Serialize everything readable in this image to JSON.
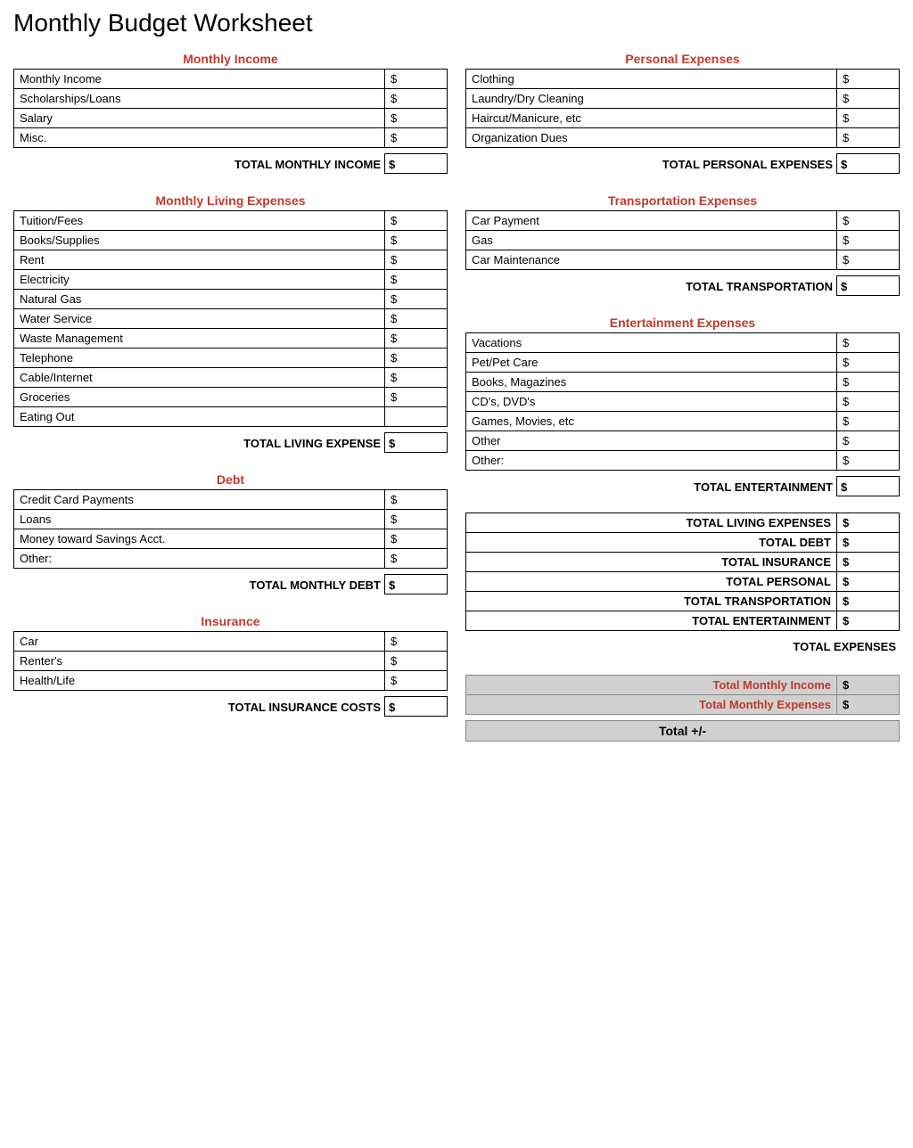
{
  "title": "Monthly Budget Worksheet",
  "left": {
    "monthly_income": {
      "heading": "Monthly Income",
      "rows": [
        {
          "label": "Monthly Income",
          "value": "$"
        },
        {
          "label": "Scholarships/Loans",
          "value": "$"
        },
        {
          "label": "Salary",
          "value": "$"
        },
        {
          "label": "Misc.",
          "value": "$"
        }
      ],
      "total_label": "TOTAL MONTHLY INCOME",
      "total_value": "$"
    },
    "living_expenses": {
      "heading": "Monthly Living Expenses",
      "rows": [
        {
          "label": "Tuition/Fees",
          "value": "$"
        },
        {
          "label": "Books/Supplies",
          "value": "$"
        },
        {
          "label": "Rent",
          "value": "$"
        },
        {
          "label": "Electricity",
          "value": "$"
        },
        {
          "label": "Natural Gas",
          "value": "$"
        },
        {
          "label": "Water Service",
          "value": "$"
        },
        {
          "label": "Waste Management",
          "value": "$"
        },
        {
          "label": "Telephone",
          "value": "$"
        },
        {
          "label": "Cable/Internet",
          "value": "$"
        },
        {
          "label": "Groceries",
          "value": "$"
        },
        {
          "label": "Eating Out",
          "value": ""
        }
      ],
      "total_label": "TOTAL LIVING EXPENSE",
      "total_value": "$"
    },
    "debt": {
      "heading": "Debt",
      "rows": [
        {
          "label": "Credit Card Payments",
          "value": "$"
        },
        {
          "label": "Loans",
          "value": "$"
        },
        {
          "label": "Money toward Savings Acct.",
          "value": "$"
        },
        {
          "label": "Other:",
          "value": "$"
        }
      ],
      "total_label": "TOTAL MONTHLY DEBT",
      "total_value": "$"
    },
    "insurance": {
      "heading": "Insurance",
      "rows": [
        {
          "label": "Car",
          "value": "$"
        },
        {
          "label": "Renter's",
          "value": "$"
        },
        {
          "label": "Health/Life",
          "value": "$"
        }
      ],
      "total_label": "TOTAL INSURANCE COSTS",
      "total_value": "$"
    }
  },
  "right": {
    "personal_expenses": {
      "heading": "Personal Expenses",
      "rows": [
        {
          "label": "Clothing",
          "value": "$"
        },
        {
          "label": "Laundry/Dry Cleaning",
          "value": "$"
        },
        {
          "label": "Haircut/Manicure, etc",
          "value": "$"
        },
        {
          "label": "Organization Dues",
          "value": "$"
        }
      ],
      "total_label": "TOTAL PERSONAL EXPENSES",
      "total_value": "$"
    },
    "transportation": {
      "heading": "Transportation Expenses",
      "rows": [
        {
          "label": "Car Payment",
          "value": "$"
        },
        {
          "label": "Gas",
          "value": "$"
        },
        {
          "label": "Car Maintenance",
          "value": "$"
        }
      ],
      "total_label": "TOTAL TRANSPORTATION",
      "total_value": "$"
    },
    "entertainment": {
      "heading": "Entertainment Expenses",
      "rows": [
        {
          "label": "Vacations",
          "value": "$"
        },
        {
          "label": "Pet/Pet Care",
          "value": "$"
        },
        {
          "label": "Books, Magazines",
          "value": "$"
        },
        {
          "label": "CD's, DVD's",
          "value": "$"
        },
        {
          "label": "Games, Movies, etc",
          "value": "$"
        },
        {
          "label": "Other",
          "value": "$"
        },
        {
          "label": "Other:",
          "value": "$"
        }
      ],
      "total_label": "TOTAL ENTERTAINMENT",
      "total_value": "$"
    },
    "summary": {
      "rows": [
        {
          "label": "TOTAL LIVING EXPENSES",
          "value": "$"
        },
        {
          "label": "TOTAL DEBT",
          "value": "$"
        },
        {
          "label": "TOTAL INSURANCE",
          "value": "$"
        },
        {
          "label": "TOTAL PERSONAL",
          "value": "$"
        },
        {
          "label": "TOTAL TRANSPORTATION",
          "value": "$"
        },
        {
          "label": "TOTAL ENTERTAINMENT",
          "value": "$"
        }
      ],
      "total_expenses_label": "TOTAL EXPENSES"
    },
    "grand_total": {
      "rows": [
        {
          "label": "Total Monthly Income",
          "value": "$"
        },
        {
          "label": "Total Monthly Expenses",
          "value": "$"
        }
      ],
      "final_label": "Total +/-"
    }
  }
}
